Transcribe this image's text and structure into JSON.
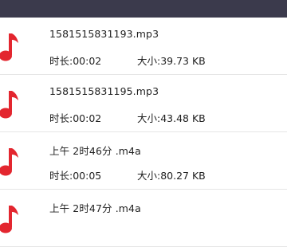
{
  "colors": {
    "top_bar": "#3b3a4c",
    "icon": "#e3262f",
    "divider": "#e6e6e6"
  },
  "recordings": [
    {
      "icon": "music-note-icon",
      "name": "1581515831193.mp3",
      "duration": "时长:00:02",
      "size": "大小:39.73 KB"
    },
    {
      "icon": "music-note-icon",
      "name": "1581515831195.mp3",
      "duration": "时长:00:02",
      "size": "大小:43.48 KB"
    },
    {
      "icon": "music-note-icon",
      "name": "上午 2时46分 .m4a",
      "duration": "时长:00:05",
      "size": "大小:80.27 KB"
    },
    {
      "icon": "music-note-icon",
      "name": "上午 2时47分 .m4a",
      "duration": "",
      "size": ""
    }
  ]
}
